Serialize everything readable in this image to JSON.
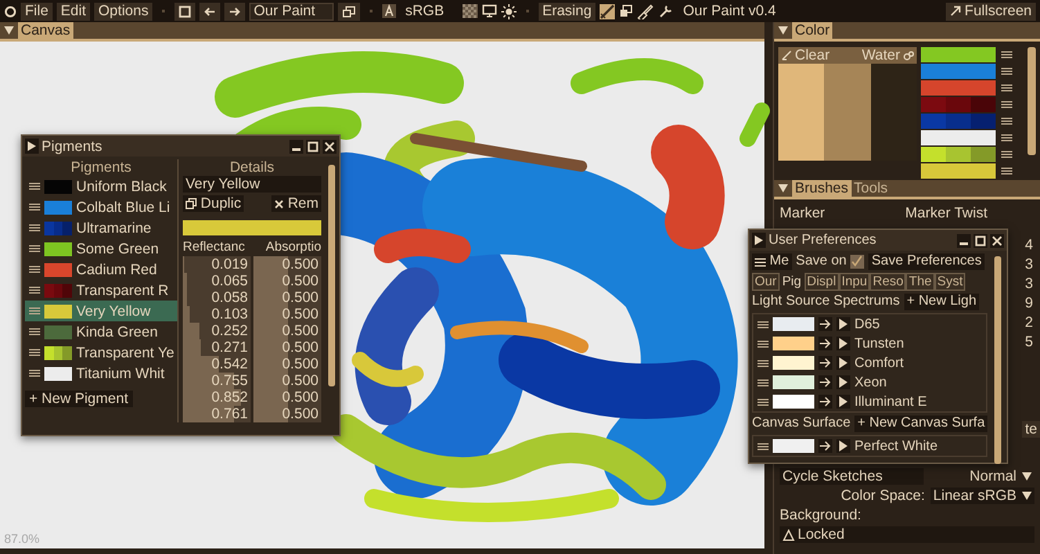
{
  "menu_bar": {
    "items": [
      "File",
      "Edit",
      "Options"
    ],
    "document_name": "Our Paint",
    "color_space": "sRGB",
    "mode": "Erasing",
    "app_title": "Our Paint v0.4",
    "fullscreen": "Fullscreen"
  },
  "canvas_panel": {
    "title": "Canvas",
    "zoom": "87.0%"
  },
  "pigments_window": {
    "title": "Pigments",
    "list_heading": "Pigments",
    "details_heading": "Details",
    "pigments": [
      {
        "name": "Uniform Black",
        "segments": [
          {
            "color": "#050505"
          }
        ],
        "selected": false
      },
      {
        "name": "Colbalt Blue Li",
        "segments": [
          {
            "color": "#1a7fd8"
          }
        ],
        "selected": false
      },
      {
        "name": "Ultramarine",
        "segments": [
          {
            "color": "#0a36a0"
          },
          {
            "color": "#082c8a"
          },
          {
            "color": "#06206a"
          }
        ],
        "selected": false
      },
      {
        "name": "Some Green",
        "segments": [
          {
            "color": "#7ec421"
          }
        ],
        "selected": false
      },
      {
        "name": "Cadium Red",
        "segments": [
          {
            "color": "#d9462c"
          }
        ],
        "selected": false
      },
      {
        "name": "Transparent R",
        "segments": [
          {
            "color": "#7a0a0f"
          },
          {
            "color": "#6a070c"
          },
          {
            "color": "#500508"
          }
        ],
        "selected": false
      },
      {
        "name": "Very Yellow",
        "segments": [
          {
            "color": "#d8c93a"
          }
        ],
        "selected": true
      },
      {
        "name": "Kinda Green",
        "segments": [
          {
            "color": "#4c6a3c"
          }
        ],
        "selected": false
      },
      {
        "name": "Transparent Ye",
        "segments": [
          {
            "color": "#c4e02c"
          },
          {
            "color": "#a8c430"
          },
          {
            "color": "#849a28"
          }
        ],
        "selected": false
      },
      {
        "name": "Titanium Whit",
        "segments": [
          {
            "color": "#ececec"
          }
        ],
        "selected": false
      }
    ],
    "new_button": "+ New Pigment",
    "details": {
      "name": "Very Yellow",
      "duplicate_button": "Duplic",
      "remove_button": "Rem",
      "swatch": {
        "color": "#d8c93a"
      },
      "reflectance_heading": "Reflectanc",
      "absorption_heading": "Absorptio",
      "rows": [
        {
          "reflectance": {
            "value": "0.019",
            "level": 0.02
          },
          "absorption": {
            "value": "0.500",
            "level": 0.5
          }
        },
        {
          "reflectance": {
            "value": "0.065",
            "level": 0.07
          },
          "absorption": {
            "value": "0.500",
            "level": 0.5
          }
        },
        {
          "reflectance": {
            "value": "0.058",
            "level": 0.06
          },
          "absorption": {
            "value": "0.500",
            "level": 0.5
          }
        },
        {
          "reflectance": {
            "value": "0.103",
            "level": 0.1
          },
          "absorption": {
            "value": "0.500",
            "level": 0.5
          }
        },
        {
          "reflectance": {
            "value": "0.252",
            "level": 0.25
          },
          "absorption": {
            "value": "0.500",
            "level": 0.5
          }
        },
        {
          "reflectance": {
            "value": "0.271",
            "level": 0.27
          },
          "absorption": {
            "value": "0.500",
            "level": 0.5
          }
        },
        {
          "reflectance": {
            "value": "0.542",
            "level": 0.54
          },
          "absorption": {
            "value": "0.500",
            "level": 0.5
          }
        },
        {
          "reflectance": {
            "value": "0.755",
            "level": 0.76
          },
          "absorption": {
            "value": "0.500",
            "level": 0.5
          }
        },
        {
          "reflectance": {
            "value": "0.852",
            "level": 0.85
          },
          "absorption": {
            "value": "0.500",
            "level": 0.5
          }
        },
        {
          "reflectance": {
            "value": "0.761",
            "level": 0.76
          },
          "absorption": {
            "value": "0.500",
            "level": 0.5
          }
        }
      ]
    }
  },
  "color_panel": {
    "title": "Color",
    "clear_label": "Clear",
    "water_label": "Water",
    "mix_segments": [
      {
        "color": "#e0b77a"
      },
      {
        "color": "#a68557"
      },
      {
        "color": "#2e2417"
      }
    ],
    "palette": [
      {
        "segments": [
          {
            "color": "#84c822"
          }
        ]
      },
      {
        "segments": [
          {
            "color": "#1a80d8"
          }
        ]
      },
      {
        "segments": [
          {
            "color": "#d6452c"
          }
        ]
      },
      {
        "segments": [
          {
            "color": "#7c0a10"
          },
          {
            "color": "#6a070c"
          },
          {
            "color": "#4a0508"
          }
        ]
      },
      {
        "segments": [
          {
            "color": "#0a38a4"
          },
          {
            "color": "#082e8c"
          },
          {
            "color": "#062070"
          }
        ]
      },
      {
        "segments": [
          {
            "color": "#ececec"
          }
        ]
      },
      {
        "segments": [
          {
            "color": "#c4e02c"
          },
          {
            "color": "#a8c430"
          },
          {
            "color": "#849a28"
          }
        ]
      },
      {
        "segments": [
          {
            "color": "#d8c83a"
          }
        ]
      }
    ]
  },
  "brushes_panel": {
    "tabs": [
      {
        "label": "Brushes",
        "selected": true
      },
      {
        "label": "Tools",
        "selected": false
      }
    ],
    "brushes": [
      "Marker",
      "Marker Twist"
    ],
    "column_3": [
      "4",
      "3",
      "3",
      "9",
      "2",
      "5"
    ],
    "cut_label": "te",
    "cycle_sketches": "Cycle Sketches",
    "blend_mode": "Normal",
    "color_space_label": "Color Space:",
    "color_space_value": "Linear sRGB",
    "background_label": "Background:",
    "background_value": "Locked"
  },
  "user_preferences": {
    "title": "User Preferences",
    "menu_button": "Me",
    "save_on_label": "Save on",
    "save_checked": true,
    "save_button": "Save Preferences",
    "tabs": [
      {
        "label": "Our",
        "selected": false
      },
      {
        "label": "Pig",
        "selected": true
      },
      {
        "label": "Displ",
        "selected": false
      },
      {
        "label": "Inpu",
        "selected": false
      },
      {
        "label": "Reso",
        "selected": false
      },
      {
        "label": "The",
        "selected": false
      },
      {
        "label": "Syst",
        "selected": false
      }
    ],
    "light_heading": "Light Source Spectrums",
    "new_light_button": "+ New Ligh",
    "lights": [
      {
        "name": "D65",
        "color": "#e8ecf0"
      },
      {
        "name": "Tunsten",
        "color": "#ffd08a"
      },
      {
        "name": "Comfort",
        "color": "#fff4d0"
      },
      {
        "name": "Xeon",
        "color": "#e0f0dc"
      },
      {
        "name": "Illuminant E",
        "color": "#ffffff"
      }
    ],
    "surface_heading": "Canvas Surface",
    "new_surface_button": "+ New Canvas Surfa",
    "surfaces": [
      {
        "name": "Perfect White",
        "color": "#f0f0f0"
      }
    ]
  }
}
